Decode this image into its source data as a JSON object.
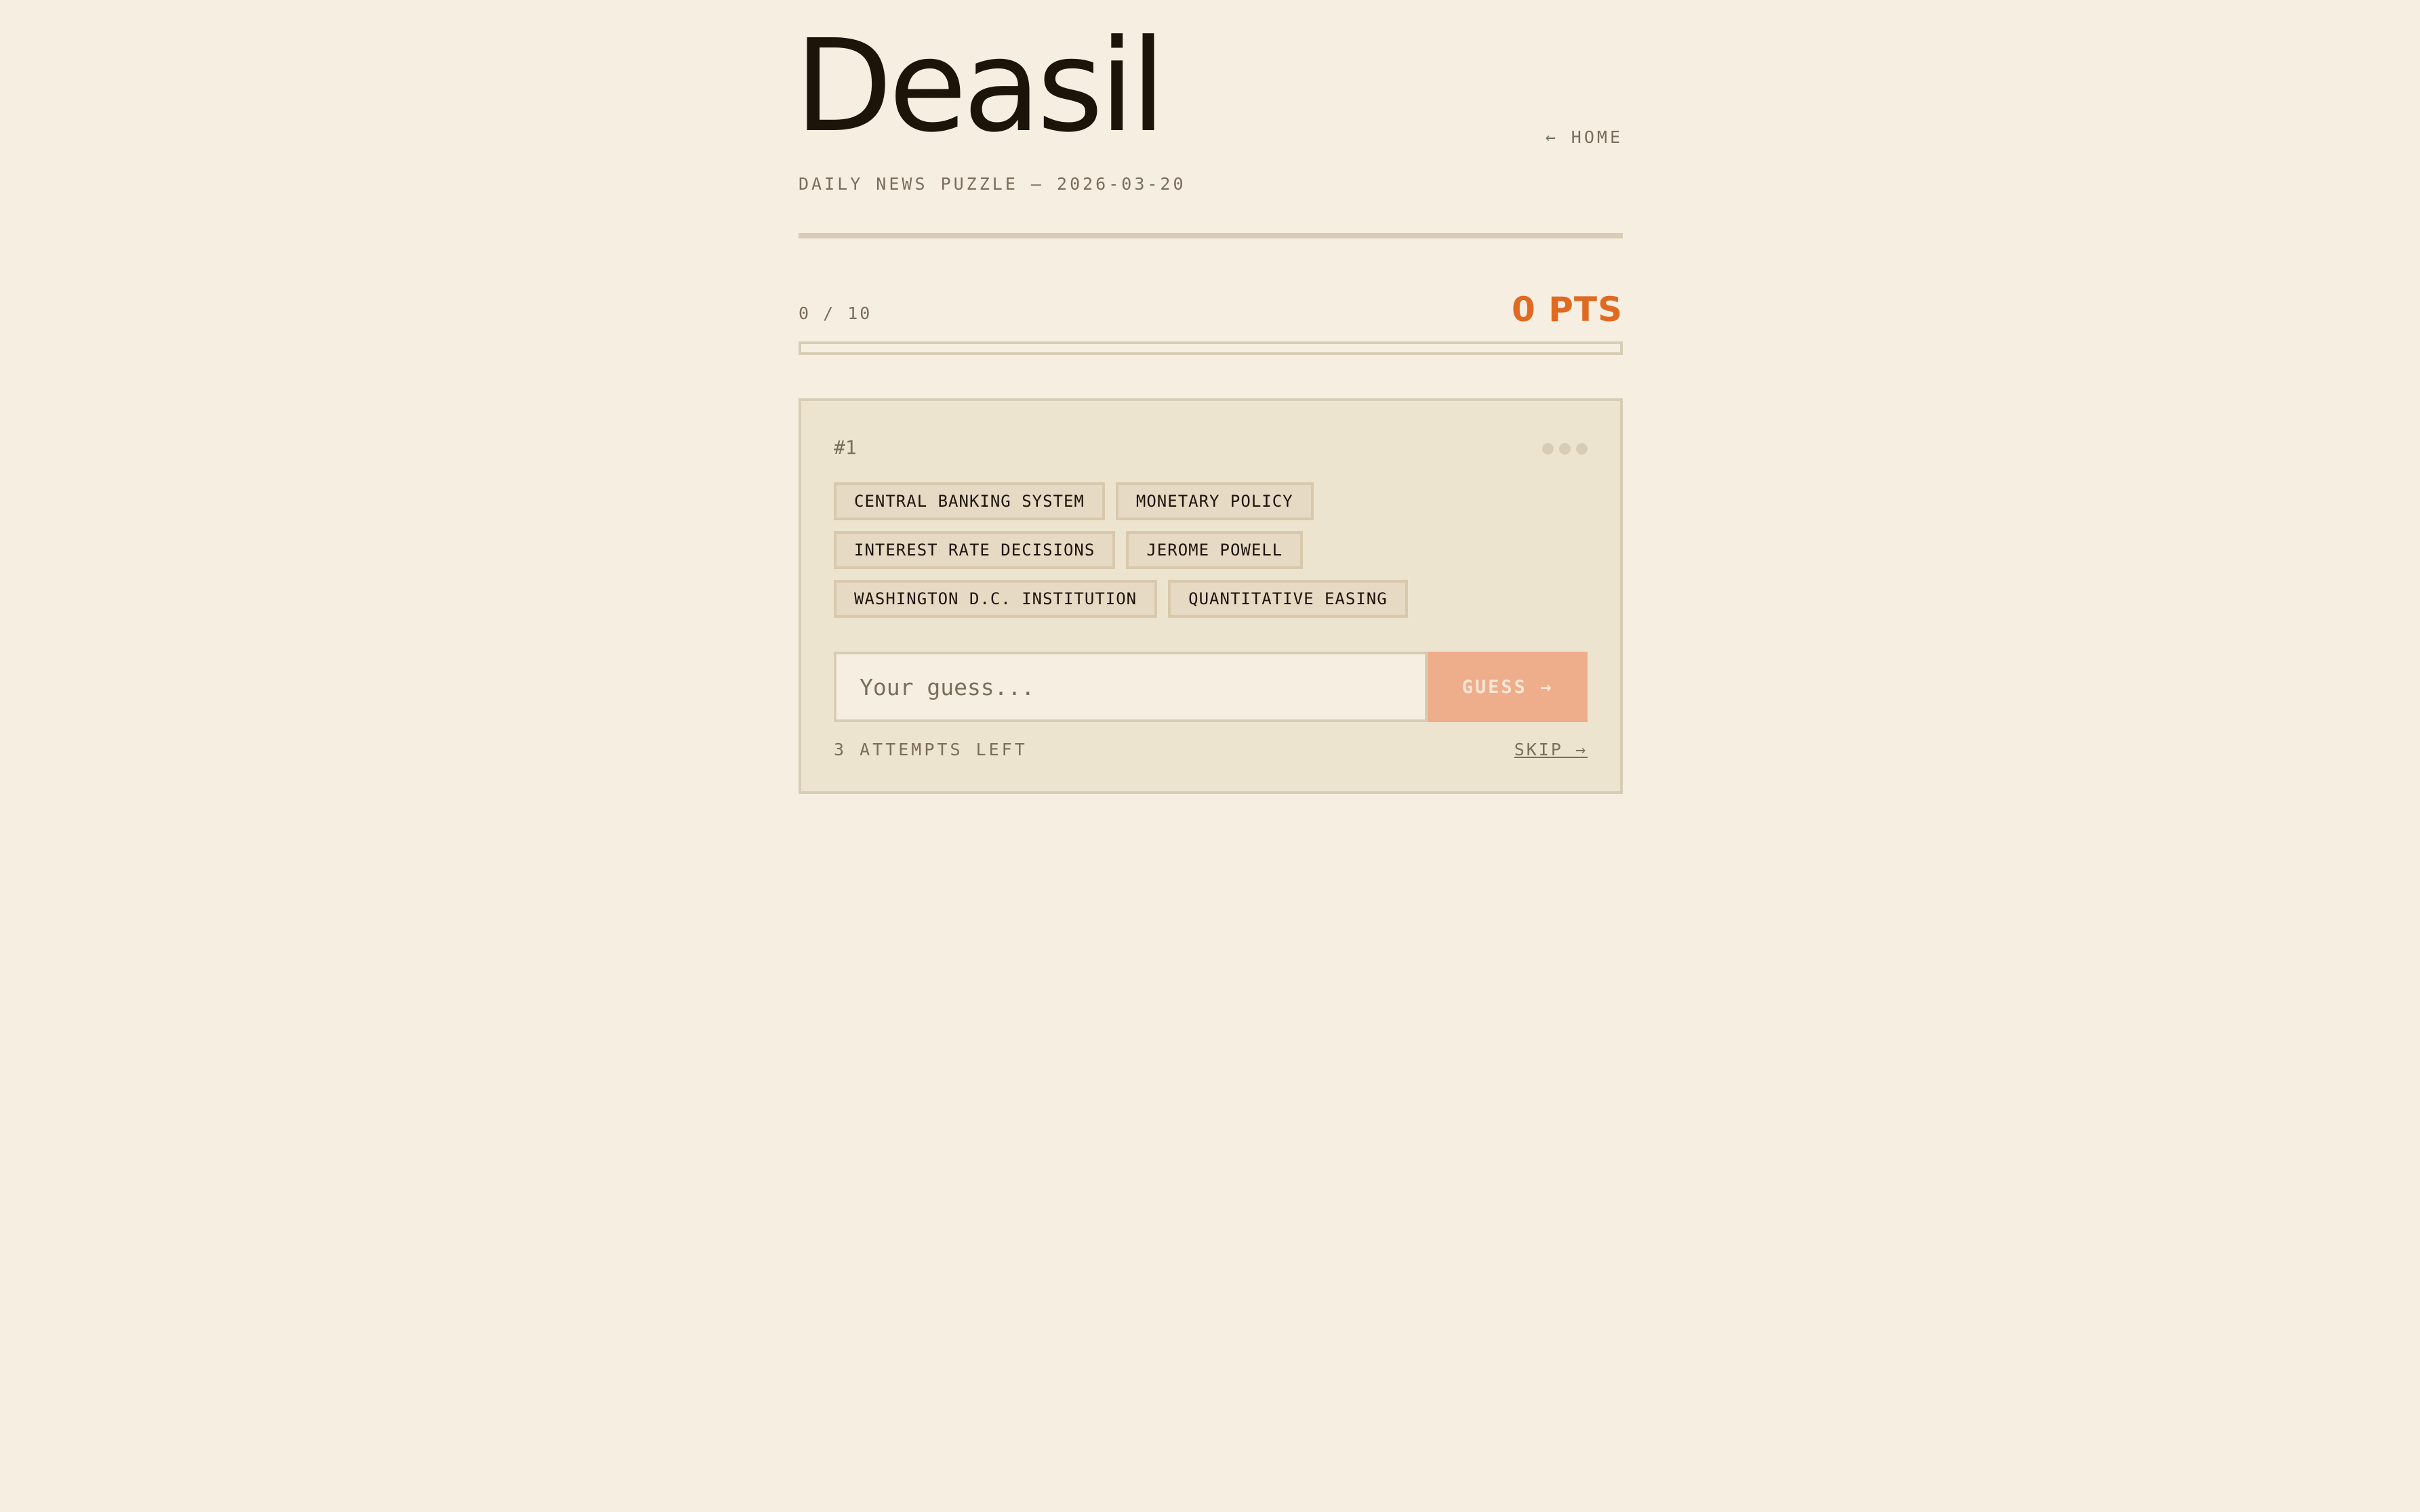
{
  "header": {
    "title": "Deasil",
    "subtitle": "DAILY NEWS PUZZLE — 2026-03-20",
    "home_link": "← HOME"
  },
  "progress": {
    "count": "0 / 10",
    "fraction": 0,
    "score": "0 PTS"
  },
  "card": {
    "number": "#1",
    "dots_icon": "more-dots-icon",
    "tag_rows": [
      [
        "CENTRAL BANKING SYSTEM",
        "MONETARY POLICY"
      ],
      [
        "INTEREST RATE DECISIONS",
        "JEROME POWELL"
      ],
      [
        "WASHINGTON D.C. INSTITUTION",
        "QUANTITATIVE EASING"
      ]
    ],
    "guess_placeholder": "Your guess...",
    "guess_value": "",
    "guess_button": "GUESS →",
    "attempts": "3 ATTEMPTS LEFT",
    "skip": "SKIP →"
  },
  "colors": {
    "background": "#f6eee1",
    "accent": "#e06a22",
    "card": "#ede4d0",
    "muted": "#7a6d5c"
  }
}
